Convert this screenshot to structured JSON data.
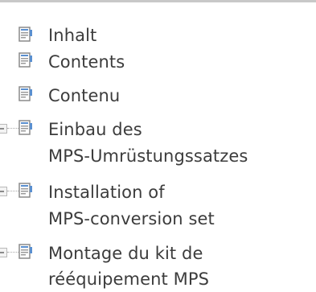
{
  "tree": {
    "items": [
      {
        "label": "Inhalt",
        "expandable": false
      },
      {
        "label": "Contents",
        "expandable": false
      },
      {
        "label": "Contenu",
        "expandable": false
      },
      {
        "line1": "Einbau des",
        "line2": "MPS-Umrüstungssatzes",
        "expandable": true
      },
      {
        "line1": "Installation of",
        "line2": "MPS-conversion set",
        "expandable": true
      },
      {
        "line1": "Montage du kit de",
        "line2": "rééquipement MPS",
        "expandable": true
      }
    ]
  },
  "colors": {
    "text": "#3c3c3c",
    "icon_page": "#ffffff",
    "icon_outline": "#8a8a8a",
    "icon_accent": "#5a8fcf",
    "connector": "#a8a8a8"
  },
  "icons": {
    "document": "document-icon",
    "expander": "expand-toggle-icon"
  }
}
